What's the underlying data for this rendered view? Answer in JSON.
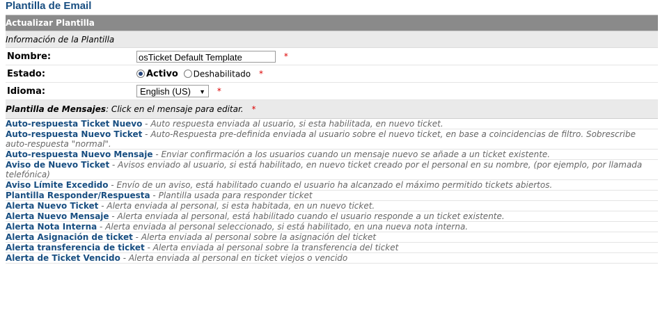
{
  "page_title": "Plantilla de Email",
  "form": {
    "header": "Actualizar Plantilla",
    "info_label": "Información de la Plantilla",
    "name_label": "Nombre:",
    "name_value": "osTicket Default Template",
    "required_mark": "*",
    "status_label": "Estado:",
    "status_active": "Activo",
    "status_disabled": "Deshabilitado",
    "lang_label": "Idioma:",
    "lang_value": "English (US)",
    "messages_title": "Plantilla de Mensajes",
    "messages_hint": ": Click en el mensaje para editar."
  },
  "messages": [
    {
      "title": "Auto-respuesta Ticket Nuevo",
      "desc": "Auto respuesta enviada al usuario, si esta habilitada, en nuevo ticket."
    },
    {
      "title": "Auto-respuesta Nuevo Ticket",
      "desc": "Auto-Respuesta pre-definida enviada al usuario sobre el nuevo ticket, en base a coincidencias de filtro. Sobrescribe auto-respuesta \"normal\"."
    },
    {
      "title": "Auto-respuesta Nuevo Mensaje",
      "desc": "Enviar confirmación a los usuarios cuando un mensaje nuevo se añade a un ticket existente."
    },
    {
      "title": "Aviso de Nuevo Ticket",
      "desc": "Avisos enviado al usuario, si está habilitado, en nuevo ticket creado por el personal en su nombre, (por ejemplo, por llamada telefónica)"
    },
    {
      "title": "Aviso Límite Excedido",
      "desc": "Envío de un aviso, está habilitado cuando el usuario ha alcanzado el máximo permitido tickets abiertos."
    },
    {
      "title": "Plantilla Responder/Respuesta",
      "desc": "Plantilla usada para responder ticket"
    },
    {
      "title": "Alerta Nuevo Ticket",
      "desc": "Alerta enviada al personal, si esta habitada, en un nuevo ticket."
    },
    {
      "title": "Alerta Nuevo Mensaje",
      "desc": "Alerta enviada al personal, está habilitado cuando el usuario responde a un ticket existente."
    },
    {
      "title": "Alerta Nota Interna",
      "desc": "Alerta enviada al personal seleccionado, si está habilitado, en una nueva nota interna."
    },
    {
      "title": "Alerta Asignación de ticket",
      "desc": "Alerta enviada al personal sobre la asignación del ticket"
    },
    {
      "title": "Alerta transferencia de ticket",
      "desc": "Alerta enviada al personal sobre la transferencia del ticket"
    },
    {
      "title": "Alerta de Ticket Vencido",
      "desc": "Alerta enviada al personal en ticket viejos o vencido"
    }
  ]
}
